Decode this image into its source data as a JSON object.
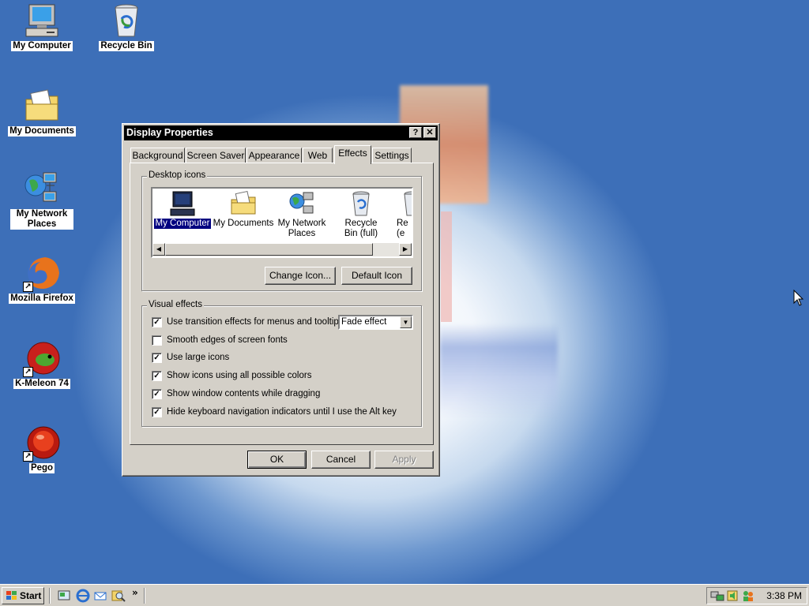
{
  "desktop": {
    "icons": [
      {
        "label": "My Computer",
        "icon": "computer-icon"
      },
      {
        "label": "Recycle Bin",
        "icon": "recycle-bin-icon"
      },
      {
        "label": "My Documents",
        "icon": "folder-documents-icon"
      },
      {
        "label": "My Network Places",
        "icon": "network-icon"
      },
      {
        "label": "Mozilla Firefox",
        "icon": "firefox-icon"
      },
      {
        "label": "K-Meleon 74",
        "icon": "k-meleon-icon"
      },
      {
        "label": "Pego",
        "icon": "pego-icon"
      }
    ]
  },
  "dialog": {
    "title": "Display Properties",
    "help_glyph": "?",
    "close_glyph": "✕",
    "tabs": [
      "Background",
      "Screen Saver",
      "Appearance",
      "Web",
      "Effects",
      "Settings"
    ],
    "active_tab": "Effects",
    "desktop_icons": {
      "group_label": "Desktop icons",
      "items": [
        {
          "label": "My Computer",
          "icon": "computer-icon",
          "selected": true
        },
        {
          "label": "My Documents",
          "icon": "folder-documents-icon",
          "selected": false
        },
        {
          "label": "My Network Places",
          "icon": "network-icon",
          "selected": false
        },
        {
          "label": "Recycle Bin (full)",
          "icon": "recycle-bin-icon",
          "selected": false
        },
        {
          "label": "Rec (e",
          "icon": "recycle-bin-icon",
          "selected": false
        }
      ],
      "change_icon_button": "Change Icon...",
      "default_icon_button": "Default Icon"
    },
    "visual_effects": {
      "group_label": "Visual effects",
      "options": [
        {
          "label": "Use transition effects for menus and tooltips",
          "checked": true
        },
        {
          "label": "Smooth edges of screen fonts",
          "checked": false
        },
        {
          "label": "Use large icons",
          "checked": true
        },
        {
          "label": "Show icons using all possible colors",
          "checked": true
        },
        {
          "label": "Show window contents while dragging",
          "checked": true
        },
        {
          "label": "Hide keyboard navigation indicators until I use the Alt key",
          "checked": true
        }
      ],
      "transition_select_value": "Fade effect"
    },
    "buttons": {
      "ok": "OK",
      "cancel": "Cancel",
      "apply": "Apply"
    }
  },
  "taskbar": {
    "start_label": "Start",
    "quick_launch": [
      "show-desktop-icon",
      "internet-explorer-icon",
      "outlook-express-icon",
      "search-icon"
    ],
    "overflow": "»",
    "tray_icons": [
      "network-tray-icon",
      "volume-tray-icon",
      "users-tray-icon"
    ],
    "clock": "3:38 PM"
  }
}
